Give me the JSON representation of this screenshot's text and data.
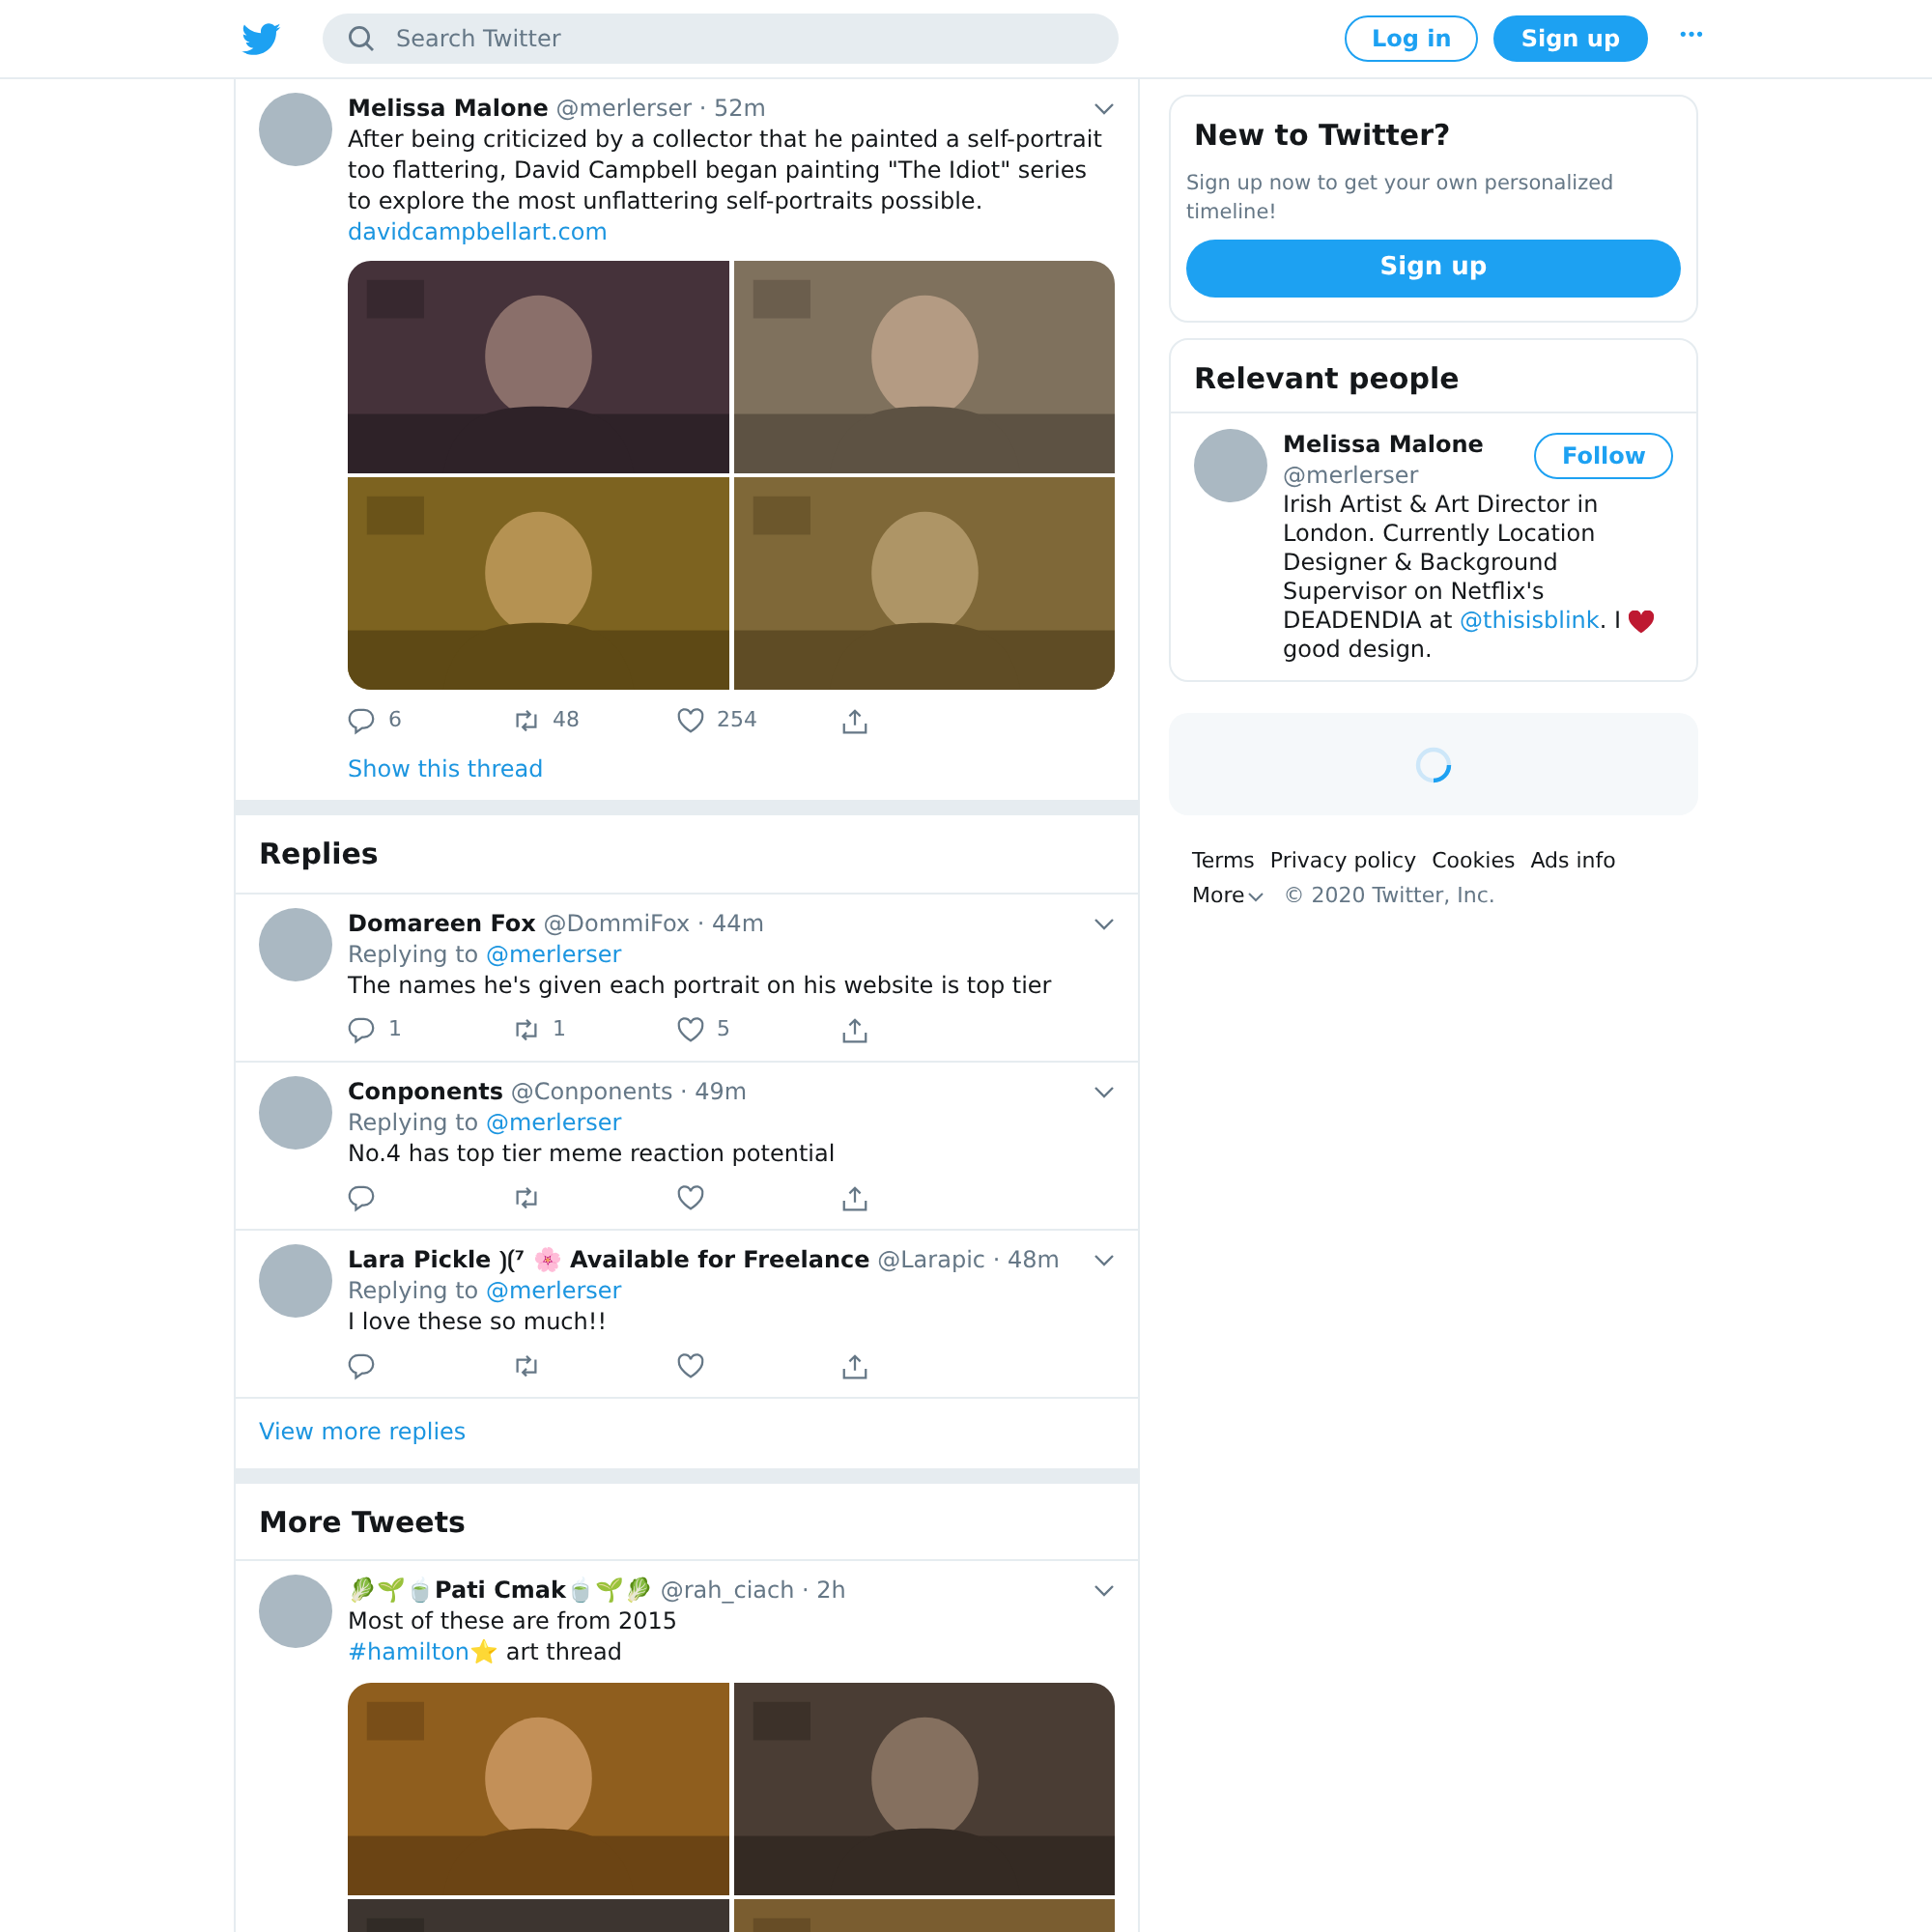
{
  "header": {
    "search_placeholder": "Search Twitter",
    "login": "Log in",
    "signup": "Sign up",
    "more": "•••"
  },
  "main_tweet": {
    "name": "Melissa Malone",
    "handle": "@merlerser",
    "time": "· 52m",
    "text": "After being criticized by a collector that he painted a self-portrait too flattering, David Campbell began painting \"The Idiot\" series to explore the most unflattering self-portraits possible.",
    "link": "davidcampbellart.com",
    "stats": {
      "replies": "6",
      "retweets": "48",
      "likes": "254"
    },
    "show_thread": "Show this thread"
  },
  "replies": {
    "title": "Replies",
    "items": [
      {
        "name": "Domareen Fox",
        "handle": "@DommiFox",
        "time": "· 44m",
        "replying_label": "Replying to",
        "replying_to": "@merlerser",
        "text": "The names he's given each portrait on his website is top tier",
        "stats": {
          "replies": "1",
          "retweets": "1",
          "likes": "5"
        }
      },
      {
        "name": "Conponents",
        "handle": "@Conponents",
        "time": "· 49m",
        "replying_label": "Replying to",
        "replying_to": "@merlerser",
        "text": "No.4 has top tier meme reaction potential"
      },
      {
        "name": "Lara Pickle ⟯⟮⁷ 🌸 Available for Freelance",
        "handle": "@Larapic",
        "time": "· 48m",
        "replying_label": "Replying to",
        "replying_to": "@merlerser",
        "text": "I love these so much!!"
      }
    ],
    "more": "View more replies"
  },
  "more_tweets": {
    "title": "More Tweets",
    "items": [
      {
        "name": "🥬🌱🍵Pati Cmak🍵🌱🥬",
        "handle": "@rah_ciach",
        "time": "· 2h",
        "text": "Most of these are from 2015",
        "hashtag": "#hamilton",
        "after_hashtag": "⭐ art thread"
      }
    ]
  },
  "sidebar": {
    "new_to_twitter": {
      "title": "New to Twitter?",
      "text": "Sign up now to get your own personalized timeline!",
      "button": "Sign up"
    },
    "relevant_people": {
      "title": "Relevant people",
      "people": [
        {
          "name": "Melissa Malone",
          "handle": "@merlerser",
          "follow": "Follow",
          "bio_before": "Irish Artist & Art Director in London. Currently Location Designer & Background Supervisor on Netflix's DEADENDIA at ",
          "bio_link": "@thisisblink",
          "bio_mid": ". I",
          "bio_after": "good design."
        }
      ]
    },
    "footer": {
      "links": [
        "Terms",
        "Privacy policy",
        "Cookies",
        "Ads info"
      ],
      "more": "More",
      "copyright": "© 2020 Twitter, Inc."
    }
  }
}
